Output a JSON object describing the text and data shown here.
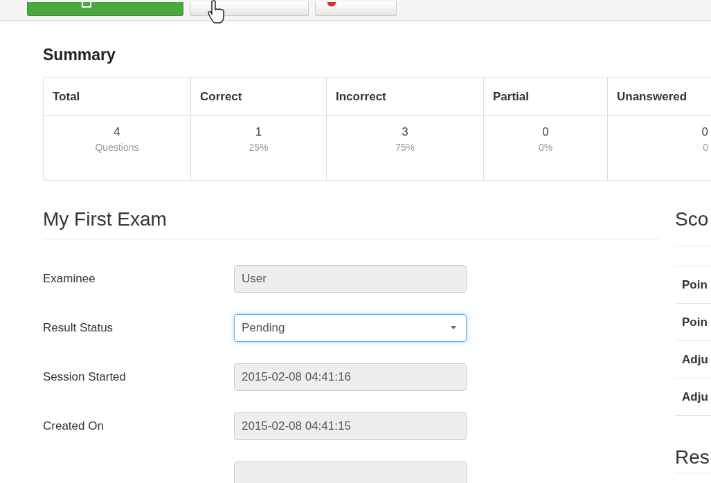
{
  "toolbar": {
    "buttons": [
      {
        "kind": "save"
      },
      {
        "kind": "save-close"
      },
      {
        "kind": "cancel"
      }
    ]
  },
  "summary": {
    "title": "Summary",
    "columns": [
      "Total",
      "Correct",
      "Incorrect",
      "Partial",
      "Unanswered"
    ],
    "cells": [
      {
        "value": "4",
        "note": "Questions"
      },
      {
        "value": "1",
        "note": "25%"
      },
      {
        "value": "3",
        "note": "75%"
      },
      {
        "value": "0",
        "note": "0%"
      },
      {
        "value": "0",
        "note": "0"
      }
    ]
  },
  "exam": {
    "title": "My First Exam",
    "fields": [
      {
        "label": "Examinee",
        "kind": "readonly",
        "value": "User"
      },
      {
        "label": "Result Status",
        "kind": "select",
        "value": "Pending"
      },
      {
        "label": "Session Started",
        "kind": "readonly",
        "value": "2015-02-08 04:41:16"
      },
      {
        "label": "Created On",
        "kind": "readonly",
        "value": "2015-02-08 04:41:15"
      },
      {
        "kind": "cut"
      }
    ]
  },
  "score": {
    "title": "Sco",
    "rows": [
      "Poin",
      "Poin",
      "Adju",
      "Adju"
    ]
  },
  "results": {
    "title": "Res"
  }
}
